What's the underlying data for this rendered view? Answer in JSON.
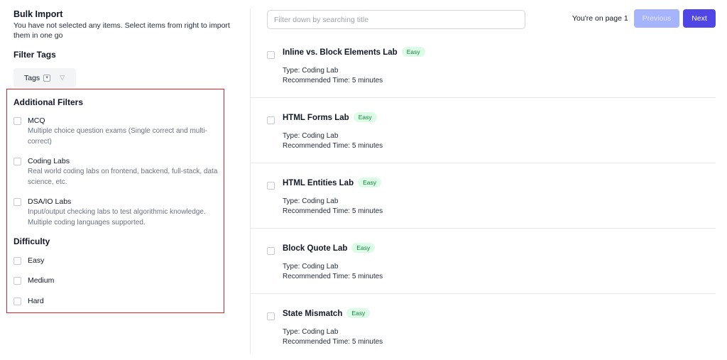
{
  "sidebar": {
    "title": "Bulk Import",
    "subtitle": "You have not selected any items. Select items from right to import them in one go",
    "filter_tags_heading": "Filter Tags",
    "tags_select_label": "Tags",
    "additional_filters": {
      "heading": "Additional Filters",
      "options": [
        {
          "label": "MCQ",
          "description": "Multiple choice question exams (Single correct and multi-correct)",
          "checked": false
        },
        {
          "label": "Coding Labs",
          "description": "Real world coding labs on frontend, backend, full-stack, data science, etc.",
          "checked": false
        },
        {
          "label": "DSA/IO Labs",
          "description": "Input/output checking labs to test algorithmic knowledge. Multiple coding languages supported.",
          "checked": false
        }
      ]
    },
    "difficulty": {
      "heading": "Difficulty",
      "options": [
        {
          "label": "Easy",
          "checked": false
        },
        {
          "label": "Medium",
          "checked": false
        },
        {
          "label": "Hard",
          "checked": false
        }
      ]
    }
  },
  "toolbar": {
    "search_placeholder": "Filter down by searching title",
    "search_value": "",
    "page_info": "You're on page 1",
    "previous_label": "Previous",
    "next_label": "Next"
  },
  "items": [
    {
      "title": "Inline vs. Block Elements Lab",
      "difficulty": "Easy",
      "type": "Type: Coding Lab",
      "time": "Recommended Time: 5 minutes"
    },
    {
      "title": "HTML Forms Lab",
      "difficulty": "Easy",
      "type": "Type: Coding Lab",
      "time": "Recommended Time: 5 minutes"
    },
    {
      "title": "HTML Entities Lab",
      "difficulty": "Easy",
      "type": "Type: Coding Lab",
      "time": "Recommended Time: 5 minutes"
    },
    {
      "title": "Block Quote Lab",
      "difficulty": "Easy",
      "type": "Type: Coding Lab",
      "time": "Recommended Time: 5 minutes"
    },
    {
      "title": "State Mismatch",
      "difficulty": "Easy",
      "type": "Type: Coding Lab",
      "time": "Recommended Time: 5 minutes"
    }
  ],
  "colors": {
    "accent": "#4f46e5",
    "accent_disabled": "#a5b4fc",
    "badge_bg": "#dcfce7",
    "badge_text": "#15803d",
    "highlight_border": "#e0202a"
  }
}
